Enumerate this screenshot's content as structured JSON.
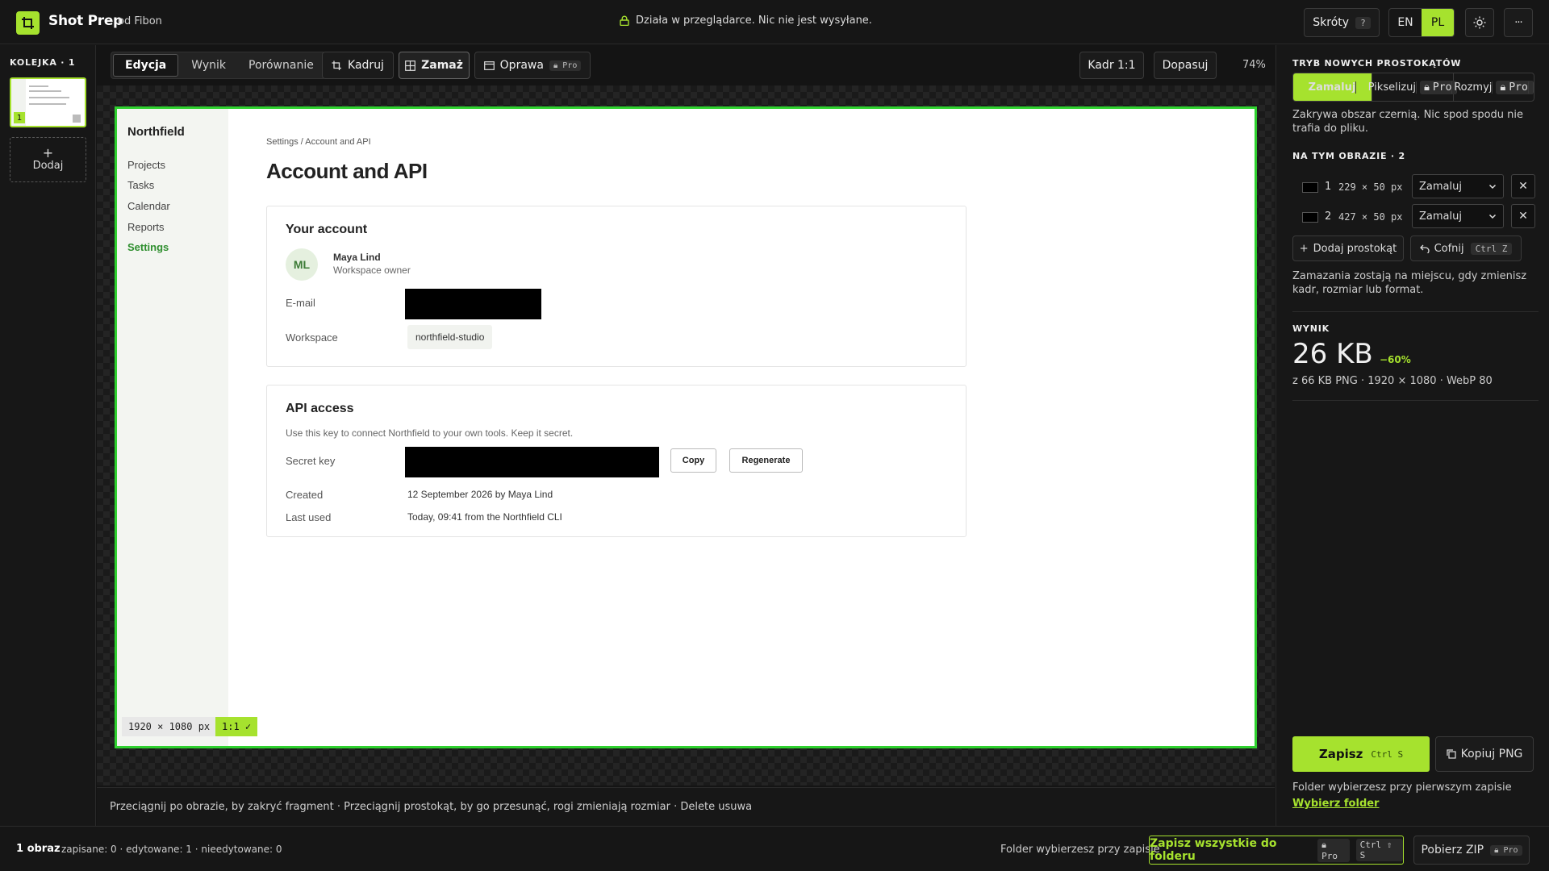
{
  "app": {
    "name": "Shot Prep",
    "by": "od Fibon",
    "status": "Działa w przeglądarce. Nic nie jest wysyłane.",
    "shortcuts_label": "Skróty",
    "shortcuts_key": "?",
    "lang_en": "EN",
    "lang_pl": "PL",
    "more_label": "···"
  },
  "queue": {
    "title": "KOLEJKA · 1",
    "thumb_index": "1",
    "add_plus": "+",
    "add_label": "Dodaj"
  },
  "toolbar": {
    "tabs": [
      "Edycja",
      "Wynik",
      "Porównanie"
    ],
    "crop_label": "Kadruj",
    "redact_label": "Zamaż",
    "frame_label": "Oprawa",
    "pro": "Pro",
    "ratio_label": "Kadr 1:1",
    "fit_label": "Dopasuj",
    "zoom": "74%"
  },
  "screenshot": {
    "brand": "Northfield",
    "nav": [
      "Projects",
      "Tasks",
      "Calendar",
      "Reports",
      "Settings"
    ],
    "breadcrumb": "Settings / Account and API",
    "heading": "Account and API",
    "account": {
      "title": "Your account",
      "initials": "ML",
      "name": "Maya Lind",
      "role": "Workspace owner",
      "email_label": "E-mail",
      "workspace_label": "Workspace",
      "workspace_value": "northfield-studio"
    },
    "api": {
      "title": "API access",
      "description": "Use this key to connect Northfield to your own tools. Keep it secret.",
      "secret_label": "Secret key",
      "copy_label": "Copy",
      "regenerate_label": "Regenerate",
      "created_label": "Created",
      "created_value": "12 September 2026 by Maya Lind",
      "last_used_label": "Last used",
      "last_used_value": "Today, 09:41 from the Northfield CLI"
    },
    "size_badge": "1920 × 1080 px",
    "ratio_badge": "1:1 ✓"
  },
  "hint": "Przeciągnij po obrazie, by zakryć fragment · Przeciągnij prostokąt, by go przesunąć, rogi zmieniają rozmiar · Delete usuwa",
  "panel": {
    "mode_title": "TRYB NOWYCH PROSTOKĄTÓW",
    "modes": [
      "Zamaluj",
      "Pikselizuj",
      "Rozmyj"
    ],
    "mode_desc": "Zakrywa obszar czernią. Nic spod spodu nie trafia do pliku.",
    "on_image_title": "NA TYM OBRAZIE · 2",
    "rects": [
      {
        "n": "1",
        "size": "229 × 50 px",
        "mode": "Zamaluj"
      },
      {
        "n": "2",
        "size": "427 × 50 px",
        "mode": "Zamaluj"
      }
    ],
    "add_rect_label": "Dodaj prostokąt",
    "undo_label": "Cofnij",
    "undo_key": "Ctrl Z",
    "persist_note": "Zamazania zostają na miejscu, gdy zmienisz kadr, rozmiar lub format.",
    "result_title": "WYNIK",
    "result_size": "26 KB",
    "result_saving": "−60%",
    "result_detail": "z 66 KB PNG · 1920 × 1080 · WebP 80",
    "save_label": "Zapisz",
    "save_key": "Ctrl S",
    "copy_png_label": "Kopiuj PNG",
    "folder_note": "Folder wybierzesz przy pierwszym zapisie",
    "choose_folder": "Wybierz folder"
  },
  "bottom": {
    "count": "1 obraz",
    "stats": "zapisane: 0 · edytowane: 1 · nieedytowane: 0",
    "folder_note": "Folder wybierzesz przy zapisie",
    "save_all_label": "Zapisz wszystkie do folderu",
    "save_all_key": "Ctrl ⇧ S",
    "zip_label": "Pobierz ZIP"
  },
  "colors": {
    "accent": "#a6e22e",
    "frame_border": "#2fd12f",
    "background": "#141414"
  }
}
